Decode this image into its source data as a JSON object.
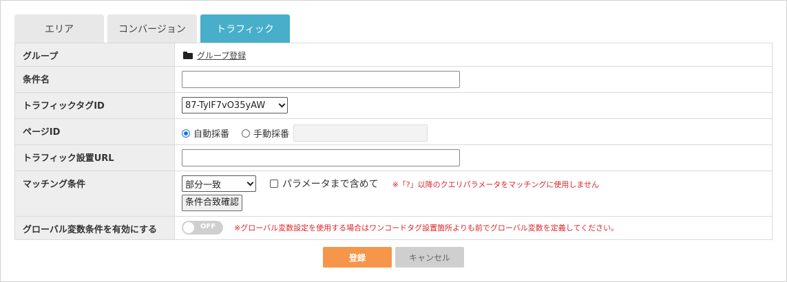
{
  "tabs": [
    {
      "label": "エリア",
      "active": false
    },
    {
      "label": "コンバージョン",
      "active": false
    },
    {
      "label": "トラフィック",
      "active": true
    }
  ],
  "form": {
    "group": {
      "label": "グループ",
      "link": "グループ登録",
      "icon": "folder-icon"
    },
    "condition_name": {
      "label": "条件名",
      "value": ""
    },
    "traffic_tag": {
      "label": "トラフィックタグID",
      "selected": "87-TylF7vO35yAW"
    },
    "page_id": {
      "label": "ページID",
      "auto": "自動採番",
      "manual": "手動採番",
      "selected": "auto",
      "manual_value": ""
    },
    "traffic_url": {
      "label": "トラフィック設置URL",
      "value": ""
    },
    "matching": {
      "label": "マッチング条件",
      "selected": "部分一致",
      "param_label": "パラメータまで含めて",
      "param_checked": false,
      "note": "※「?」以降のクエリパラメータをマッチングに使用しません",
      "confirm_button": "条件合致確認"
    },
    "global_var": {
      "label": "グローバル変数条件を有効にする",
      "toggle_text": "OFF",
      "note": "※グローバル変数設定を使用する場合はワンコードタグ設置箇所よりも前でグローバル変数を定義してください。"
    }
  },
  "actions": {
    "save": "登録",
    "cancel": "キャンセル"
  },
  "colors": {
    "active_tab": "#47afc9",
    "save": "#f5964a",
    "note": "#d9262b"
  }
}
